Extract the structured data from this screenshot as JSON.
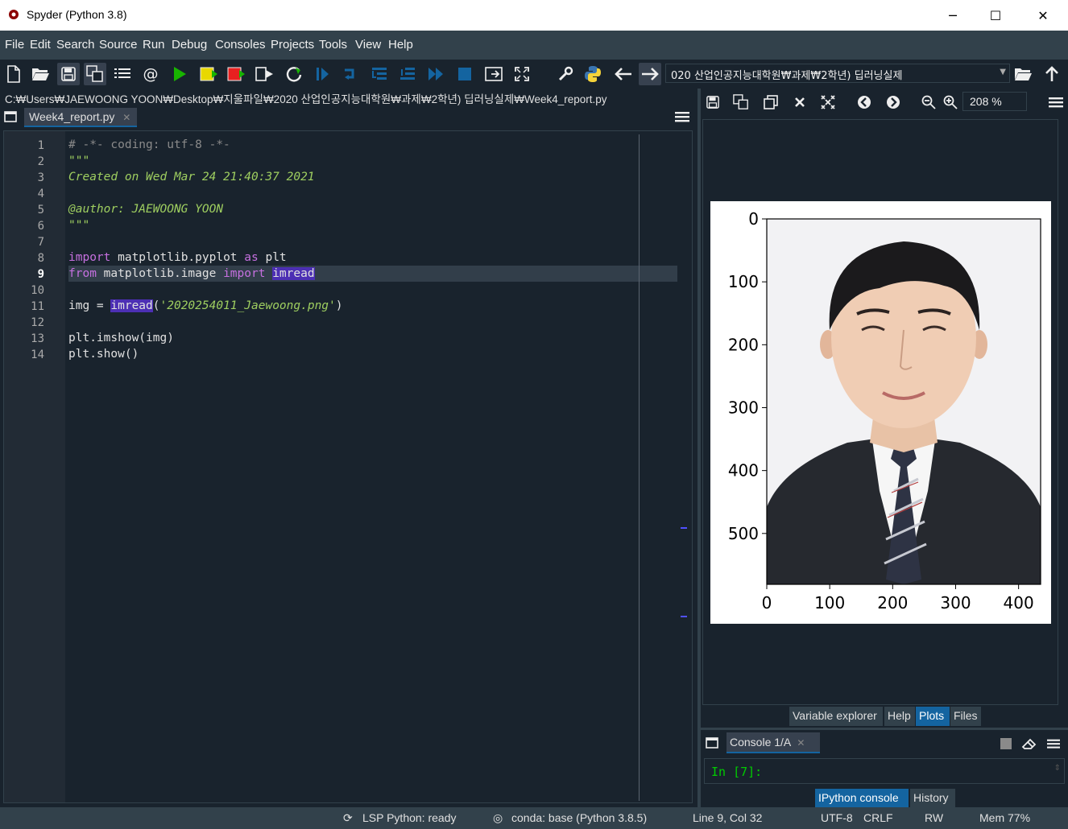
{
  "window": {
    "title": "Spyder (Python 3.8)",
    "minimize": "─",
    "maximize": "☐",
    "close": "✕"
  },
  "menu": [
    "File",
    "Edit",
    "Search",
    "Source",
    "Run",
    "Debug",
    "Consoles",
    "Projects",
    "Tools",
    "View",
    "Help"
  ],
  "toolbar": {
    "icons": [
      "new-file-icon",
      "open-file-icon",
      "save-icon",
      "save-all-icon",
      "outline-icon",
      "at-icon",
      "run-icon",
      "run-cell-icon",
      "run-cell-advance-icon",
      "run-selection-icon",
      "rerun-icon",
      "debug-icon",
      "step-icon",
      "step-into-icon",
      "step-return-icon",
      "continue-icon",
      "stop-icon",
      "maximize-pane-icon",
      "fullscreen-icon",
      "wrench-icon",
      "python-icon",
      "back-arrow-icon",
      "forward-arrow-icon"
    ],
    "working_dir": "020 산업인공지능대학원₩과제₩2학년) 딥러닝실제"
  },
  "editor": {
    "path": "C:₩Users₩JAEWOONG YOON₩Desktop₩지울파일₩2020 산업인공지능대학원₩과제₩2학년) 딥러닝실제₩Week4_report.py",
    "tab": "Week4_report.py",
    "tab_close": "✕",
    "current_line": 9,
    "lines": {
      "l1": "# -*- coding: utf-8 -*-",
      "l2": "\"\"\"",
      "l3": "Created on Wed Mar 24 21:40:37 2021",
      "l5": "@author: JAEWOONG YOON",
      "l6": "\"\"\"",
      "l8a": "import",
      "l8b": " matplotlib.pyplot ",
      "l8c": "as",
      "l8d": " plt",
      "l9a": "from",
      "l9b": " matplotlib.image ",
      "l9c": "import",
      "l9d": " ",
      "l9e": "imread",
      "l11a": "img = ",
      "l11b": "imread",
      "l11c": "(",
      "l11d": "'2020254011_Jaewoong.png'",
      "l11e": ")",
      "l13": "plt.imshow(img)",
      "l14": "plt.show()"
    },
    "line_numbers": [
      "1",
      "2",
      "3",
      "4",
      "5",
      "6",
      "7",
      "8",
      "9",
      "10",
      "11",
      "12",
      "13",
      "14"
    ]
  },
  "plots_toolbar": {
    "zoom": "208 %"
  },
  "plot": {
    "x_ticks": [
      "0",
      "100",
      "200",
      "300",
      "400"
    ],
    "y_ticks": [
      "0",
      "100",
      "200",
      "300",
      "400",
      "500"
    ]
  },
  "pane_tabs": [
    "Variable explorer",
    "Help",
    "Plots",
    "Files"
  ],
  "console": {
    "tab": "Console 1/A",
    "tab_close": "✕",
    "prompt": "In [7]:"
  },
  "console_tabs": [
    "IPython console",
    "History"
  ],
  "status": {
    "lsp": "LSP Python: ready",
    "conda": "conda: base (Python 3.8.5)",
    "cursor": "Line 9, Col 32",
    "encoding": "UTF-8",
    "eol": "CRLF",
    "perm": "RW",
    "mem": "Mem 77%"
  }
}
